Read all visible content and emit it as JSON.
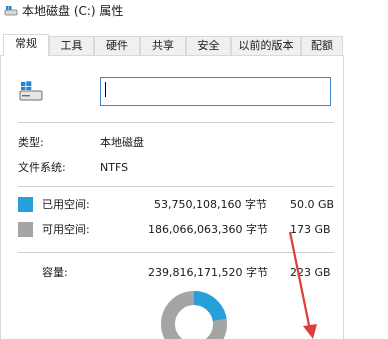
{
  "window": {
    "title": "本地磁盘 (C:) 属性",
    "icon": "drive-icon"
  },
  "tabs": [
    {
      "label": "常规",
      "active": true
    },
    {
      "label": "工具"
    },
    {
      "label": "硬件"
    },
    {
      "label": "共享"
    },
    {
      "label": "安全"
    },
    {
      "label": "以前的版本"
    },
    {
      "label": "配额"
    }
  ],
  "general": {
    "drive_icon": "hard-drive-windows-icon",
    "volume_label_value": "",
    "type_label": "类型:",
    "type_value": "本地磁盘",
    "fs_label": "文件系统:",
    "fs_value": "NTFS",
    "used": {
      "label": "已用空间:",
      "bytes": "53,750,108,160 字节",
      "size": "50.0 GB",
      "color": "#26a0da"
    },
    "free": {
      "label": "可用空间:",
      "bytes": "186,066,063,360 字节",
      "size": "173 GB",
      "color": "#a5a5a5"
    },
    "capacity": {
      "label": "容量:",
      "bytes": "239,816,171,520 字节",
      "size": "223 GB"
    },
    "used_fraction": 0.224
  },
  "overlay": {
    "arrow_color": "#e03c3c"
  }
}
